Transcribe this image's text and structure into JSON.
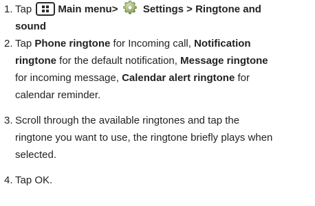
{
  "steps": [
    {
      "number": "1.",
      "tap": "Tap",
      "main_menu": "Main menu>",
      "settings_path": "Settings > Ringtone and",
      "sound": "sound"
    },
    {
      "number": "2.",
      "tap": "Tap",
      "phone_ringtone": "Phone ringtone",
      "t1": "for Incoming call,",
      "notification": "Notification",
      "ringtone_word": "ringtone",
      "t2": "for the default notification,",
      "message_ringtone": "Message ringtone",
      "t3": "for incoming message,",
      "calendar_ringtone": "Calendar alert ringtone",
      "t4": "for",
      "t5": "calendar reminder."
    },
    {
      "number": "3.",
      "line1": "Scroll through the available ringtones and tap the",
      "line2": "ringtone you want to use, the ringtone briefly plays when",
      "line3": "selected."
    },
    {
      "number": "4.",
      "text": "Tap OK."
    }
  ],
  "icons": {
    "menu": "main-menu-icon",
    "settings": "settings-gear-icon"
  }
}
